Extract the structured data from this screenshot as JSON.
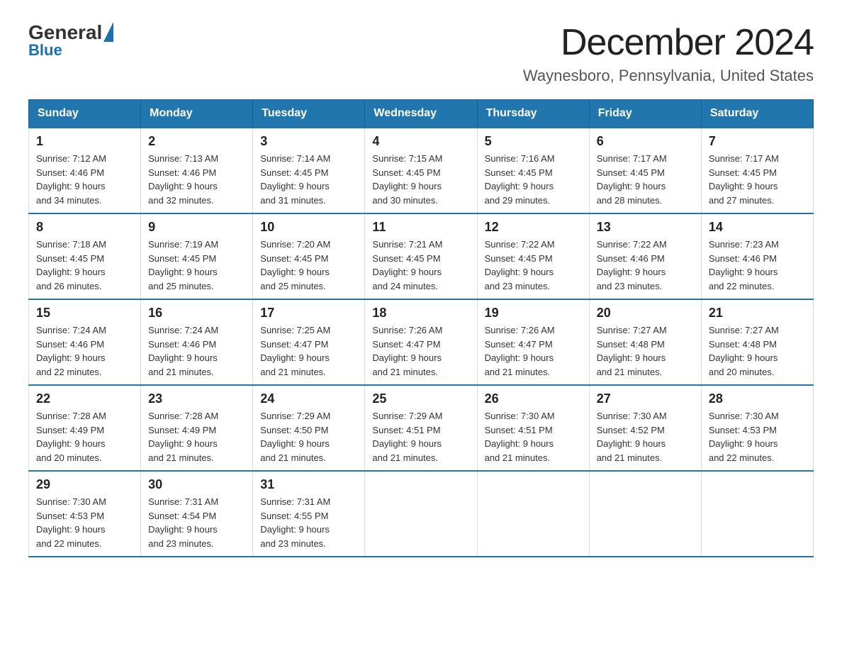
{
  "logo": {
    "text_general": "General",
    "text_blue": "Blue"
  },
  "title": "December 2024",
  "subtitle": "Waynesboro, Pennsylvania, United States",
  "weekdays": [
    "Sunday",
    "Monday",
    "Tuesday",
    "Wednesday",
    "Thursday",
    "Friday",
    "Saturday"
  ],
  "weeks": [
    [
      {
        "day": "1",
        "sunrise": "7:12 AM",
        "sunset": "4:46 PM",
        "daylight": "9 hours and 34 minutes."
      },
      {
        "day": "2",
        "sunrise": "7:13 AM",
        "sunset": "4:46 PM",
        "daylight": "9 hours and 32 minutes."
      },
      {
        "day": "3",
        "sunrise": "7:14 AM",
        "sunset": "4:45 PM",
        "daylight": "9 hours and 31 minutes."
      },
      {
        "day": "4",
        "sunrise": "7:15 AM",
        "sunset": "4:45 PM",
        "daylight": "9 hours and 30 minutes."
      },
      {
        "day": "5",
        "sunrise": "7:16 AM",
        "sunset": "4:45 PM",
        "daylight": "9 hours and 29 minutes."
      },
      {
        "day": "6",
        "sunrise": "7:17 AM",
        "sunset": "4:45 PM",
        "daylight": "9 hours and 28 minutes."
      },
      {
        "day": "7",
        "sunrise": "7:17 AM",
        "sunset": "4:45 PM",
        "daylight": "9 hours and 27 minutes."
      }
    ],
    [
      {
        "day": "8",
        "sunrise": "7:18 AM",
        "sunset": "4:45 PM",
        "daylight": "9 hours and 26 minutes."
      },
      {
        "day": "9",
        "sunrise": "7:19 AM",
        "sunset": "4:45 PM",
        "daylight": "9 hours and 25 minutes."
      },
      {
        "day": "10",
        "sunrise": "7:20 AM",
        "sunset": "4:45 PM",
        "daylight": "9 hours and 25 minutes."
      },
      {
        "day": "11",
        "sunrise": "7:21 AM",
        "sunset": "4:45 PM",
        "daylight": "9 hours and 24 minutes."
      },
      {
        "day": "12",
        "sunrise": "7:22 AM",
        "sunset": "4:45 PM",
        "daylight": "9 hours and 23 minutes."
      },
      {
        "day": "13",
        "sunrise": "7:22 AM",
        "sunset": "4:46 PM",
        "daylight": "9 hours and 23 minutes."
      },
      {
        "day": "14",
        "sunrise": "7:23 AM",
        "sunset": "4:46 PM",
        "daylight": "9 hours and 22 minutes."
      }
    ],
    [
      {
        "day": "15",
        "sunrise": "7:24 AM",
        "sunset": "4:46 PM",
        "daylight": "9 hours and 22 minutes."
      },
      {
        "day": "16",
        "sunrise": "7:24 AM",
        "sunset": "4:46 PM",
        "daylight": "9 hours and 21 minutes."
      },
      {
        "day": "17",
        "sunrise": "7:25 AM",
        "sunset": "4:47 PM",
        "daylight": "9 hours and 21 minutes."
      },
      {
        "day": "18",
        "sunrise": "7:26 AM",
        "sunset": "4:47 PM",
        "daylight": "9 hours and 21 minutes."
      },
      {
        "day": "19",
        "sunrise": "7:26 AM",
        "sunset": "4:47 PM",
        "daylight": "9 hours and 21 minutes."
      },
      {
        "day": "20",
        "sunrise": "7:27 AM",
        "sunset": "4:48 PM",
        "daylight": "9 hours and 21 minutes."
      },
      {
        "day": "21",
        "sunrise": "7:27 AM",
        "sunset": "4:48 PM",
        "daylight": "9 hours and 20 minutes."
      }
    ],
    [
      {
        "day": "22",
        "sunrise": "7:28 AM",
        "sunset": "4:49 PM",
        "daylight": "9 hours and 20 minutes."
      },
      {
        "day": "23",
        "sunrise": "7:28 AM",
        "sunset": "4:49 PM",
        "daylight": "9 hours and 21 minutes."
      },
      {
        "day": "24",
        "sunrise": "7:29 AM",
        "sunset": "4:50 PM",
        "daylight": "9 hours and 21 minutes."
      },
      {
        "day": "25",
        "sunrise": "7:29 AM",
        "sunset": "4:51 PM",
        "daylight": "9 hours and 21 minutes."
      },
      {
        "day": "26",
        "sunrise": "7:30 AM",
        "sunset": "4:51 PM",
        "daylight": "9 hours and 21 minutes."
      },
      {
        "day": "27",
        "sunrise": "7:30 AM",
        "sunset": "4:52 PM",
        "daylight": "9 hours and 21 minutes."
      },
      {
        "day": "28",
        "sunrise": "7:30 AM",
        "sunset": "4:53 PM",
        "daylight": "9 hours and 22 minutes."
      }
    ],
    [
      {
        "day": "29",
        "sunrise": "7:30 AM",
        "sunset": "4:53 PM",
        "daylight": "9 hours and 22 minutes."
      },
      {
        "day": "30",
        "sunrise": "7:31 AM",
        "sunset": "4:54 PM",
        "daylight": "9 hours and 23 minutes."
      },
      {
        "day": "31",
        "sunrise": "7:31 AM",
        "sunset": "4:55 PM",
        "daylight": "9 hours and 23 minutes."
      },
      null,
      null,
      null,
      null
    ]
  ],
  "labels": {
    "sunrise": "Sunrise:",
    "sunset": "Sunset:",
    "daylight": "Daylight:"
  }
}
